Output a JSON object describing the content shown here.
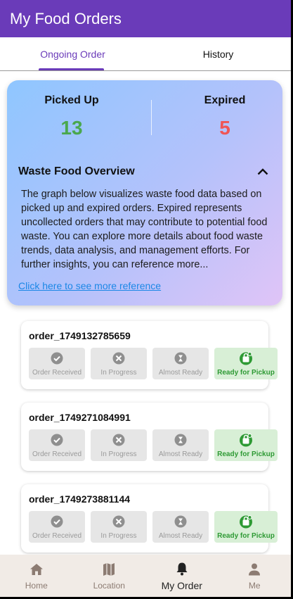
{
  "appbar": {
    "title": "My Food Orders"
  },
  "tabs": [
    {
      "label": "Ongoing Order",
      "active": true
    },
    {
      "label": "History",
      "active": false
    }
  ],
  "summary": {
    "picked_up_label": "Picked Up",
    "picked_up_value": "13",
    "expired_label": "Expired",
    "expired_value": "5",
    "overview_title": "Waste Food Overview",
    "overview_text": "The graph below visualizes waste food data based on picked up and expired orders. Expired represents uncollected orders that may contribute to potential food waste. You can explore more details about food waste trends, data analysis, and management efforts. For further insights, you can reference more...",
    "reference_link": "Click here to see more reference",
    "colors": {
      "picked_up": "#4aa84e",
      "expired": "#f05555"
    }
  },
  "steps": [
    {
      "label": "Order Received",
      "icon": "check-circle-icon"
    },
    {
      "label": "In Progress",
      "icon": "utensils-icon"
    },
    {
      "label": "Almost Ready",
      "icon": "hourglass-icon"
    },
    {
      "label": "Ready for Pickup",
      "icon": "shopping-bag-icon"
    }
  ],
  "orders": [
    {
      "id": "order_1749132785659",
      "current_step": "Ready for Pickup"
    },
    {
      "id": "order_1749271084991",
      "current_step": "Ready for Pickup"
    },
    {
      "id": "order_1749273881144",
      "current_step": "Ready for Pickup"
    }
  ],
  "bottom_nav": [
    {
      "label": "Home",
      "icon": "home-icon",
      "active": false
    },
    {
      "label": "Location",
      "icon": "map-icon",
      "active": false
    },
    {
      "label": "My Order",
      "icon": "bell-icon",
      "active": true
    },
    {
      "label": "Me",
      "icon": "person-icon",
      "active": false
    }
  ],
  "colors": {
    "primary": "#6a3bb9",
    "ready_bg": "#d8efd6",
    "ready_text": "#2e9a34",
    "link": "#1b87e6"
  }
}
